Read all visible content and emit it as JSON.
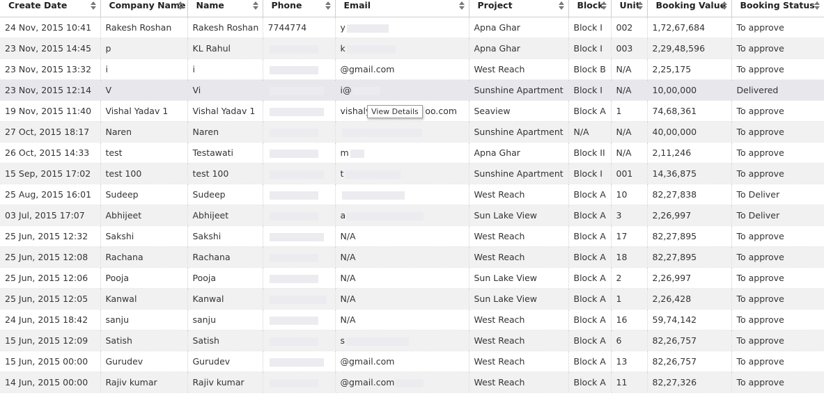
{
  "columns": [
    {
      "label": "Create Date"
    },
    {
      "label": "Company Name"
    },
    {
      "label": "Name"
    },
    {
      "label": "Phone"
    },
    {
      "label": "Email"
    },
    {
      "label": "Project"
    },
    {
      "label": "Block"
    },
    {
      "label": "Unit"
    },
    {
      "label": "Booking Value"
    },
    {
      "label": "Booking Status"
    }
  ],
  "rows": [
    {
      "create_date": "24 Nov, 2015 10:41",
      "company": "Rakesh Roshan",
      "name": "Rakesh Roshan",
      "phone": "7744774",
      "email": "y",
      "project": "Apna Ghar",
      "block": "Block I",
      "unit": "002",
      "value": "1,72,67,684",
      "status": "To approve"
    },
    {
      "create_date": "23 Nov, 2015 14:45",
      "company": "p",
      "name": "KL Rahul",
      "phone": "",
      "email": "k",
      "project": "Apna Ghar",
      "block": "Block I",
      "unit": "003",
      "value": "2,29,48,596",
      "status": "To approve"
    },
    {
      "create_date": "23 Nov, 2015 13:32",
      "company": "i",
      "name": "i",
      "phone": "",
      "email": "@gmail.com",
      "project": "West Reach",
      "block": "Block B",
      "unit": "N/A",
      "value": "2,25,175",
      "status": "To approve"
    },
    {
      "create_date": "23 Nov, 2015 12:14",
      "company": "V",
      "name": "Vi",
      "phone": "",
      "email": "i@",
      "project": "Sunshine Apartment",
      "block": "Block I",
      "unit": "N/A",
      "value": "10,00,000",
      "status": "Delivered"
    },
    {
      "create_date": "19 Nov, 2015 11:40",
      "company": "Vishal Yadav 1",
      "name": "Vishal Yadav 1",
      "phone": "",
      "email": "vishaly",
      "email_suffix": "oo.com",
      "project": "Seaview",
      "block": "Block A",
      "unit": "1",
      "value": "74,68,361",
      "status": "To approve"
    },
    {
      "create_date": "27 Oct, 2015 18:17",
      "company": "Naren",
      "name": "Naren",
      "phone": "",
      "email": "",
      "project": "Sunshine Apartment",
      "block": "N/A",
      "unit": "N/A",
      "value": "40,00,000",
      "status": "To approve"
    },
    {
      "create_date": "26 Oct, 2015 14:33",
      "company": "test",
      "name": "Testawati",
      "phone": "",
      "email": "m",
      "project": "Apna Ghar",
      "block": "Block II",
      "unit": "N/A",
      "value": "2,11,246",
      "status": "To approve"
    },
    {
      "create_date": "15 Sep, 2015 17:02",
      "company": "test 100",
      "name": "test 100",
      "phone": "",
      "email": "t",
      "project": "Sunshine Apartment",
      "block": "Block I",
      "unit": "001",
      "value": "14,36,875",
      "status": "To approve"
    },
    {
      "create_date": "25 Aug, 2015 16:01",
      "company": "Sudeep",
      "name": "Sudeep",
      "phone": "",
      "email": "",
      "project": "West Reach",
      "block": "Block A",
      "unit": "10",
      "value": "82,27,838",
      "status": "To Deliver"
    },
    {
      "create_date": "03 Jul, 2015 17:07",
      "company": "Abhijeet",
      "name": "Abhijeet",
      "phone": "",
      "email": "a",
      "project": "Sun Lake View",
      "block": "Block A",
      "unit": "3",
      "value": "2,26,997",
      "status": "To Deliver"
    },
    {
      "create_date": "25 Jun, 2015 12:32",
      "company": "Sakshi",
      "name": "Sakshi",
      "phone": "",
      "email": "N/A",
      "project": "West Reach",
      "block": "Block A",
      "unit": "17",
      "value": "82,27,895",
      "status": "To approve"
    },
    {
      "create_date": "25 Jun, 2015 12:08",
      "company": "Rachana",
      "name": "Rachana",
      "phone": "",
      "email": "N/A",
      "project": "West Reach",
      "block": "Block A",
      "unit": "18",
      "value": "82,27,895",
      "status": "To approve"
    },
    {
      "create_date": "25 Jun, 2015 12:06",
      "company": "Pooja",
      "name": "Pooja",
      "phone": "",
      "email": "N/A",
      "project": "Sun Lake View",
      "block": "Block A",
      "unit": "2",
      "value": "2,26,997",
      "status": "To approve"
    },
    {
      "create_date": "25 Jun, 2015 12:05",
      "company": "Kanwal",
      "name": "Kanwal",
      "phone": "",
      "email": "N/A",
      "project": "Sun Lake View",
      "block": "Block A",
      "unit": "1",
      "value": "2,26,428",
      "status": "To approve"
    },
    {
      "create_date": "24 Jun, 2015 18:42",
      "company": "sanju",
      "name": "sanju",
      "phone": "",
      "email": "N/A",
      "project": "West Reach",
      "block": "Block A",
      "unit": "16",
      "value": "59,74,142",
      "status": "To approve"
    },
    {
      "create_date": "15 Jun, 2015 12:09",
      "company": "Satish",
      "name": "Satish",
      "phone": "",
      "email": "s",
      "project": "West Reach",
      "block": "Block A",
      "unit": "6",
      "value": "82,26,757",
      "status": "To approve"
    },
    {
      "create_date": "15 Jun, 2015 00:00",
      "company": "Gurudev",
      "name": "Gurudev",
      "phone": "",
      "email": "@gmail.com",
      "project": "West Reach",
      "block": "Block A",
      "unit": "13",
      "value": "82,26,757",
      "status": "To approve"
    },
    {
      "create_date": "14 Jun, 2015 00:00",
      "company": "Rajiv kumar",
      "name": "Rajiv kumar",
      "phone": "",
      "email": "@gmail.com",
      "project": "West Reach",
      "block": "Block A",
      "unit": "11",
      "value": "82,27,326",
      "status": "To approve"
    }
  ],
  "tooltip": {
    "text": "View Details"
  }
}
